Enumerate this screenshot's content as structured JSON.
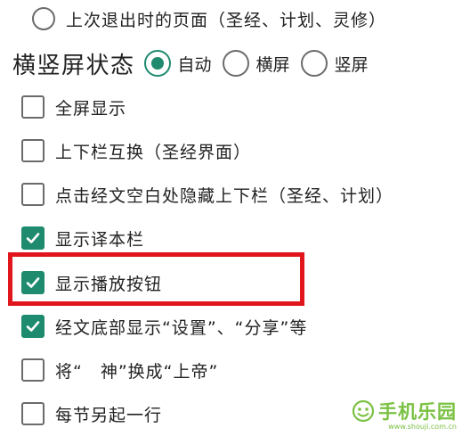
{
  "return_page_option": {
    "label": "上次退出时的页面（圣经、计划、灵修）",
    "checked": false
  },
  "orientation": {
    "title": "横竖屏状态",
    "options": [
      {
        "label": "自动",
        "checked": true
      },
      {
        "label": "横屏",
        "checked": false
      },
      {
        "label": "竖屏",
        "checked": false
      }
    ]
  },
  "settings": [
    {
      "label": "全屏显示",
      "checked": false
    },
    {
      "label": "上下栏互换（圣经界面）",
      "checked": false
    },
    {
      "label": "点击经文空白处隐藏上下栏（圣经、计划）",
      "checked": false
    },
    {
      "label": "显示译本栏",
      "checked": true
    },
    {
      "label": "显示播放按钮",
      "checked": true
    },
    {
      "label": "经文底部显示“设置”、“分享”等",
      "checked": true
    },
    {
      "label": "将“　神”换成“上帝”",
      "checked": false
    },
    {
      "label": "每节另起一行",
      "checked": false
    }
  ],
  "watermark": {
    "text": "手机乐园",
    "url": "www.shouji.com.cn"
  },
  "colors": {
    "accent": "#1e8a6e",
    "highlight": "#e0161c",
    "watermark": "#7ac143"
  }
}
